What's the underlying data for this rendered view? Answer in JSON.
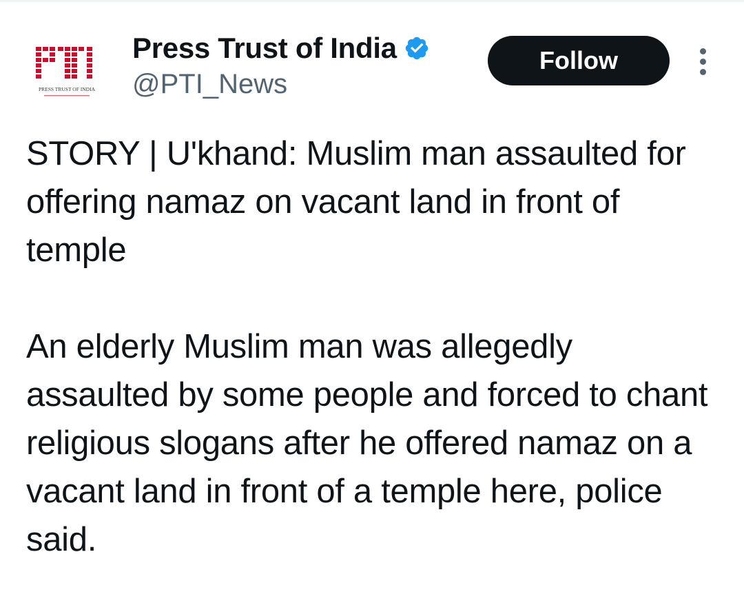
{
  "author": {
    "display_name": "Press Trust of India",
    "handle": "@PTI_News",
    "verified": true,
    "verified_color": "#1d9bf0",
    "avatar": {
      "logo_text": "PTI",
      "caption": "PRESS TRUST OF INDIA",
      "logo_color": "#c8102e"
    }
  },
  "actions": {
    "follow_label": "Follow",
    "more_icon": "more-vertical-icon"
  },
  "tweet": {
    "paragraphs": [
      "STORY | U'khand: Muslim man assaulted for offering namaz on vacant land in front of temple",
      "An elderly Muslim man was allegedly assaulted by some people and forced to chant religious slogans after he offered namaz on a vacant land in front of a temple here, police said."
    ]
  }
}
